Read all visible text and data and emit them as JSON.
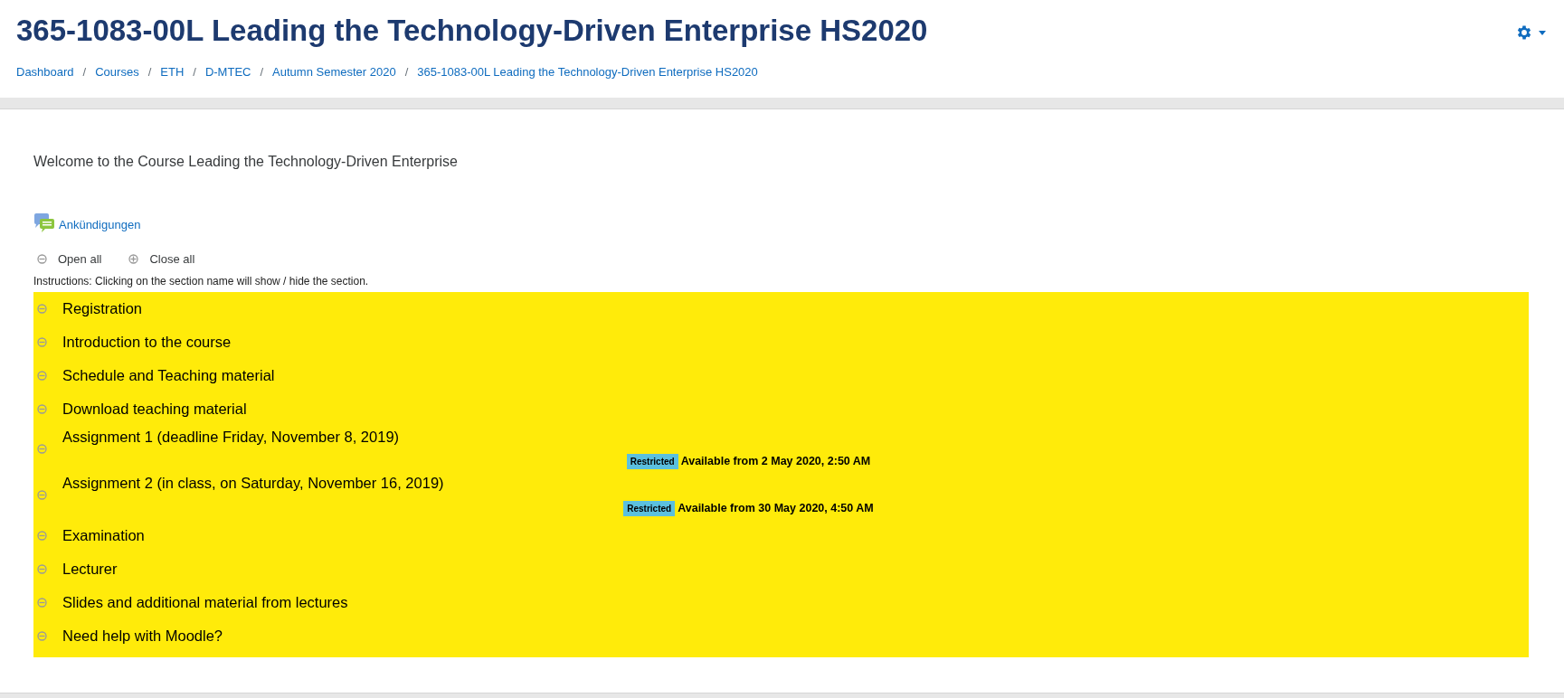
{
  "header": {
    "title": "365-1083-00L Leading the Technology-Driven Enterprise HS2020",
    "separator": "/",
    "breadcrumb": [
      "Dashboard",
      "Courses",
      "ETH",
      "D-MTEC",
      "Autumn Semester 2020",
      "365-1083-00L Leading the Technology-Driven Enterprise HS2020"
    ]
  },
  "welcome": "Welcome to the Course Leading the Technology-Driven Enterprise",
  "forum_link": "Ankündigungen",
  "controls": [
    {
      "label": "Open all",
      "kind": "open"
    },
    {
      "label": "Close all",
      "kind": "close"
    }
  ],
  "instructions": "Instructions: Clicking on the section name will show / hide the section.",
  "sections": [
    {
      "title": "Registration"
    },
    {
      "title": "Introduction to the course"
    },
    {
      "title": "Schedule and Teaching material"
    },
    {
      "title": "Download teaching material"
    },
    {
      "title": "Assignment 1 (deadline Friday, November 8, 2019)",
      "restriction": {
        "badge": "Restricted",
        "text": "Available from 2 May 2020, 2:50 AM"
      }
    },
    {
      "title": "Assignment 2 (in class, on Saturday, November 16, 2019)",
      "restriction": {
        "badge": "Restricted",
        "text": "Available from 30 May 2020, 4:50 AM"
      }
    },
    {
      "title": "Examination"
    },
    {
      "title": "Lecturer"
    },
    {
      "title": "Slides and additional material from lectures"
    },
    {
      "title": "Need help with Moodle?"
    }
  ]
}
